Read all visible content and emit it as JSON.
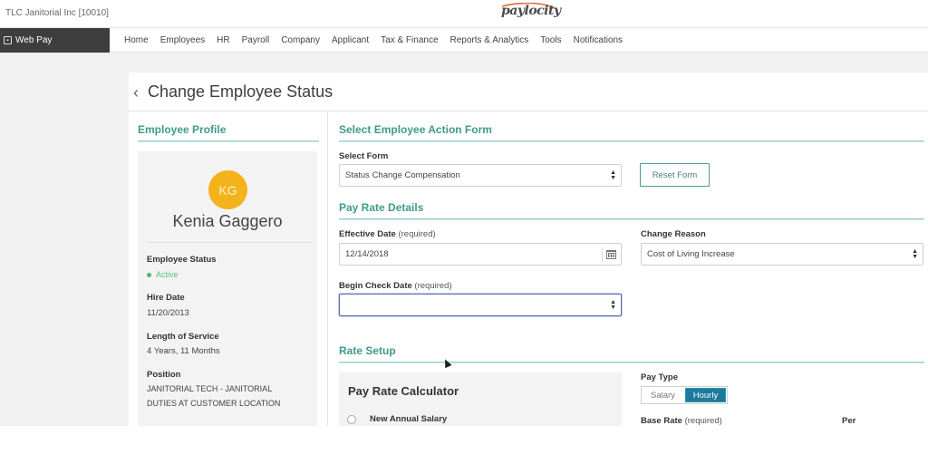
{
  "header": {
    "company": "TLC Janitorial Inc [10010]",
    "logo": "paylocity"
  },
  "nav": {
    "app": "Web Pay",
    "items": [
      "Home",
      "Employees",
      "HR",
      "Payroll",
      "Company",
      "Applicant",
      "Tax & Finance",
      "Reports & Analytics",
      "Tools",
      "Notifications"
    ]
  },
  "page": {
    "title": "Change Employee Status"
  },
  "profile": {
    "heading": "Employee Profile",
    "initials": "KG",
    "name": "Kenia Gaggero",
    "status_label": "Employee Status",
    "status_value": "Active",
    "hire_label": "Hire Date",
    "hire_value": "11/20/2013",
    "los_label": "Length of Service",
    "los_value": "4 Years, 11 Months",
    "position_label": "Position",
    "position_line1": "JANITORIAL TECH - JANITORIAL",
    "position_line2": "DUTIES AT CUSTOMER LOCATION"
  },
  "form": {
    "heading": "Select Employee Action Form",
    "select_label": "Select Form",
    "select_value": "Status Change Compensation",
    "reset_label": "Reset Form"
  },
  "pay_rate": {
    "heading": "Pay Rate Details",
    "effective_label": "Effective Date",
    "required": "(required)",
    "effective_value": "12/14/2018",
    "reason_label": "Change Reason",
    "reason_value": "Cost of Living Increase",
    "begin_label": "Begin Check Date",
    "begin_value": ""
  },
  "rate_setup": {
    "heading": "Rate Setup",
    "calc_title": "Pay Rate Calculator",
    "option1": "New Annual Salary",
    "pay_type_label": "Pay Type",
    "salary": "Salary",
    "hourly": "Hourly",
    "base_rate_label": "Base Rate",
    "per_label": "Per"
  },
  "colors": {
    "accent": "#3f9b8a",
    "hourly_active": "#1e7a9b",
    "avatar": "#f4b21b"
  }
}
